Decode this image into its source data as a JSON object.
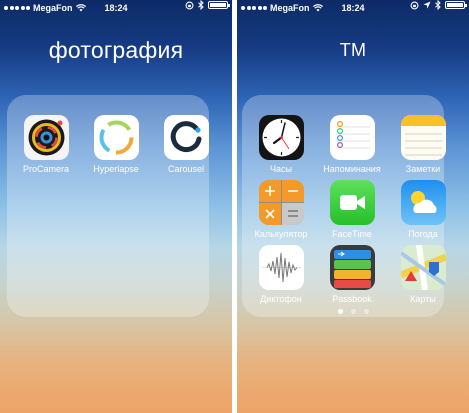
{
  "status_bar": {
    "carrier": "MegaFon",
    "time": "18:24"
  },
  "left_screen": {
    "folder_name": "фотография",
    "apps": [
      {
        "label": "ProCamera",
        "icon": "procamera-icon"
      },
      {
        "label": "Hyperlapse",
        "icon": "hyperlapse-icon"
      },
      {
        "label": "Carousel",
        "icon": "carousel-icon"
      }
    ]
  },
  "right_screen": {
    "folder_name": "TM",
    "apps": [
      {
        "label": "Часы",
        "icon": "clock-icon"
      },
      {
        "label": "Напоминания",
        "icon": "reminders-icon"
      },
      {
        "label": "Заметки",
        "icon": "notes-icon"
      },
      {
        "label": "Калькулятор",
        "icon": "calculator-icon"
      },
      {
        "label": "FaceTime",
        "icon": "facetime-icon"
      },
      {
        "label": "Погода",
        "icon": "weather-icon"
      },
      {
        "label": "Диктофон",
        "icon": "voice-memos-icon"
      },
      {
        "label": "Passbook",
        "icon": "passbook-icon"
      },
      {
        "label": "Карты",
        "icon": "maps-icon"
      }
    ],
    "page_count": 3,
    "active_page": 1
  },
  "colors": {
    "wallpaper_top": "#0d2a66",
    "wallpaper_bottom": "#eea367"
  }
}
